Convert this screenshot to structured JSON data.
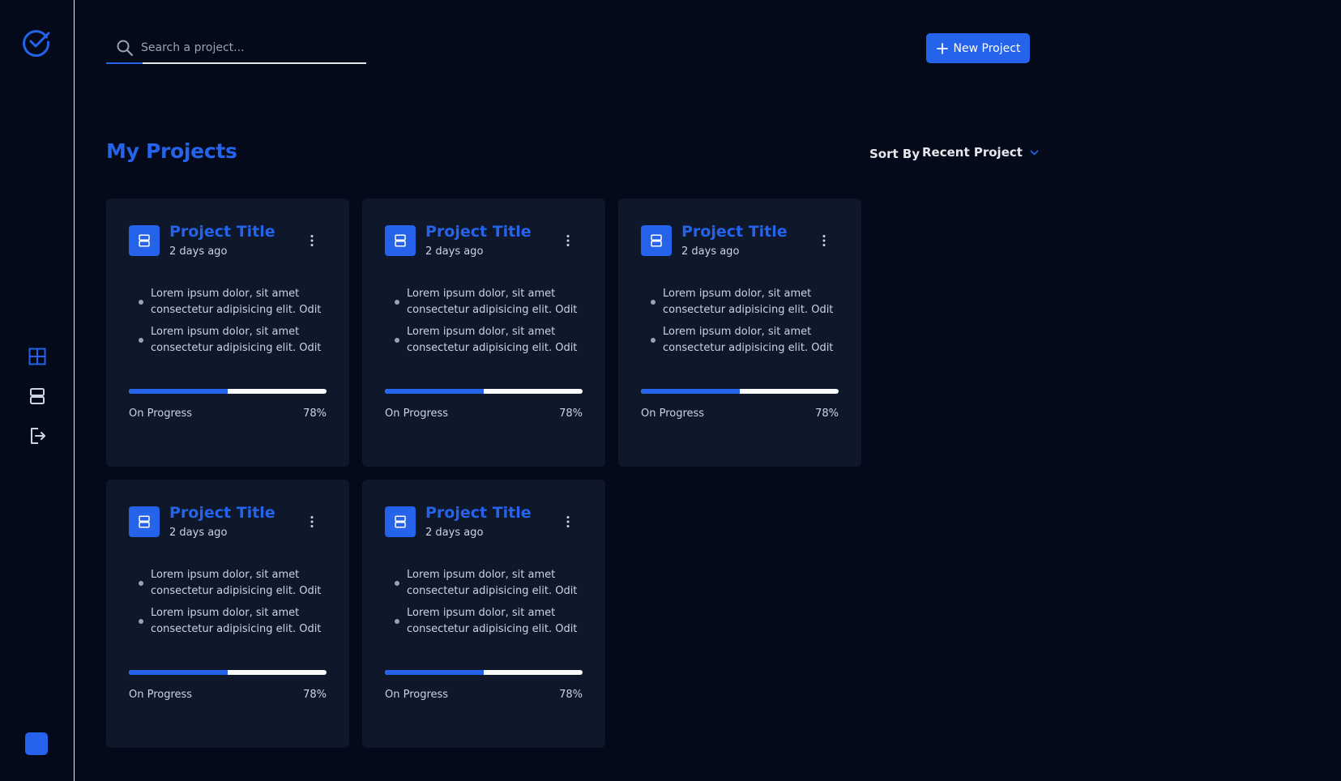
{
  "sidebar": {
    "logo_icon": "check-circle-icon",
    "nav_icons": [
      "grid-icon",
      "server-icon",
      "logout-icon"
    ],
    "accent": "#2563eb"
  },
  "search": {
    "placeholder": "Search a project..."
  },
  "header": {
    "new_project_label": "New Project"
  },
  "main": {
    "title": "My Projects",
    "sort_label": "Sort By",
    "sort_value": "Recent Project"
  },
  "projects": [
    {
      "title": "Project Title",
      "time": "2 days ago",
      "bullets": [
        "Lorem ipsum dolor, sit amet consectetur adipisicing elit. Odit",
        "Lorem ipsum dolor, sit amet consectetur adipisicing elit. Odit"
      ],
      "status": "On Progress",
      "percent_label": "78%",
      "progress": 0.5
    },
    {
      "title": "Project Title",
      "time": "2 days ago",
      "bullets": [
        "Lorem ipsum dolor, sit amet consectetur adipisicing elit. Odit",
        "Lorem ipsum dolor, sit amet consectetur adipisicing elit. Odit"
      ],
      "status": "On Progress",
      "percent_label": "78%",
      "progress": 0.5
    },
    {
      "title": "Project Title",
      "time": "2 days ago",
      "bullets": [
        "Lorem ipsum dolor, sit amet consectetur adipisicing elit. Odit",
        "Lorem ipsum dolor, sit amet consectetur adipisicing elit. Odit"
      ],
      "status": "On Progress",
      "percent_label": "78%",
      "progress": 0.5
    },
    {
      "title": "Project Title",
      "time": "2 days ago",
      "bullets": [
        "Lorem ipsum dolor, sit amet consectetur adipisicing elit. Odit",
        "Lorem ipsum dolor, sit amet consectetur adipisicing elit. Odit"
      ],
      "status": "On Progress",
      "percent_label": "78%",
      "progress": 0.5
    },
    {
      "title": "Project Title",
      "time": "2 days ago",
      "bullets": [
        "Lorem ipsum dolor, sit amet consectetur adipisicing elit. Odit",
        "Lorem ipsum dolor, sit amet consectetur adipisicing elit. Odit"
      ],
      "status": "On Progress",
      "percent_label": "78%",
      "progress": 0.5
    }
  ]
}
